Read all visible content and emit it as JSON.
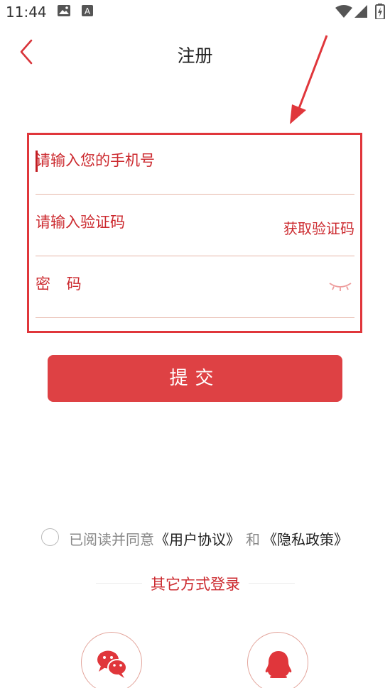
{
  "status_bar": {
    "time": "11:44",
    "left_icons": [
      "image-icon",
      "accessibility-icon"
    ],
    "right_icons": [
      "wifi-icon",
      "signal-icon",
      "battery-icon"
    ]
  },
  "header": {
    "title": "注册",
    "back_icon": "chevron-left-icon"
  },
  "form": {
    "phone": {
      "placeholder": "请输入您的手机号",
      "value": ""
    },
    "code": {
      "placeholder": "请输入验证码",
      "value": "",
      "get_code_label": "获取验证码"
    },
    "password": {
      "placeholder": "密 码",
      "value": "",
      "toggle_icon": "eye-closed-icon"
    }
  },
  "submit": {
    "label": "提交"
  },
  "agreement": {
    "prefix": "已阅读并同意",
    "user_agreement": "《用户协议》",
    "and": "和",
    "privacy_policy": "《隐私政策》",
    "checked": false
  },
  "other_login": {
    "label": "其它方式登录",
    "options": [
      {
        "name": "wechat",
        "icon": "wechat-icon"
      },
      {
        "name": "qq",
        "icon": "qq-icon"
      }
    ]
  },
  "colors": {
    "accent": "#de4144",
    "text_red": "#cc2a2f",
    "annotation": "#e0363b"
  }
}
